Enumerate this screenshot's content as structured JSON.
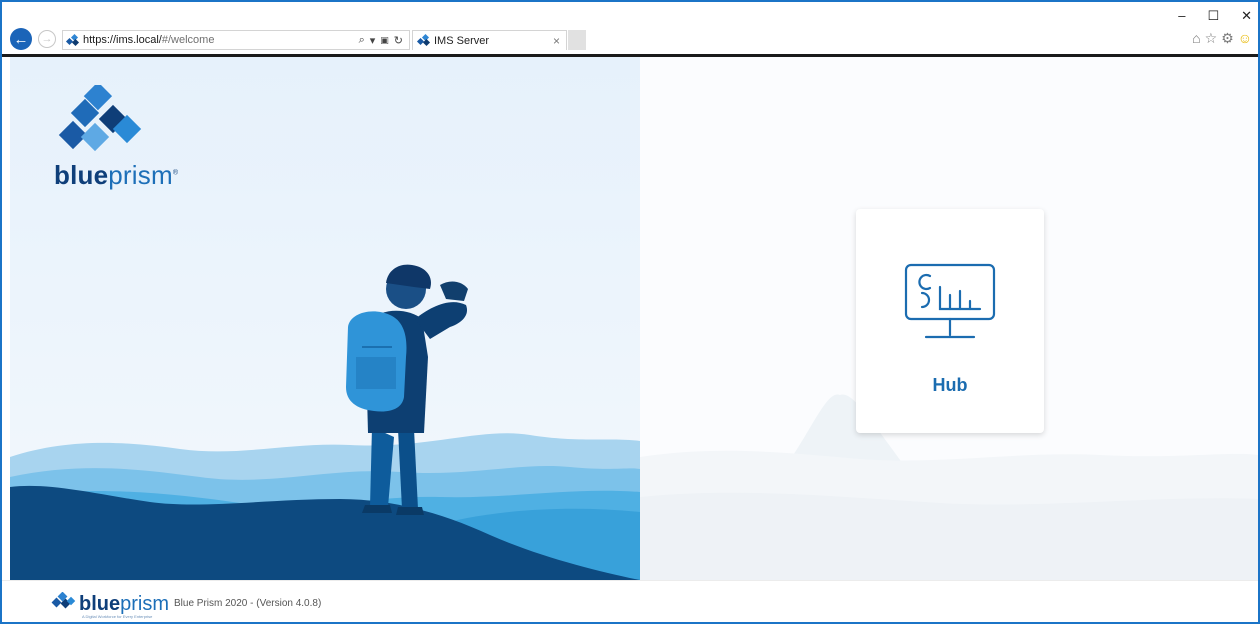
{
  "browser": {
    "address_url_host": "https://ims.local/",
    "address_url_path": "#/welcome",
    "tab_title": "IMS Server",
    "tab_close": "×",
    "search_glyph": "⌕",
    "dropdown_glyph": "▾",
    "lock_glyph": "🔒",
    "refresh_glyph": "↻",
    "window_controls": {
      "minimize": "–",
      "maximize": "☐",
      "close": "✕"
    },
    "toolbar": {
      "home": "⌂",
      "favorites": "☆",
      "settings": "⚙",
      "feedback": "☺"
    },
    "back_glyph": "←",
    "forward_glyph": "→"
  },
  "brand": {
    "bold": "blue",
    "light": "prism",
    "registered": "®"
  },
  "hub": {
    "label": "Hub"
  },
  "footer": {
    "brand_bold": "blue",
    "brand_light": "prism",
    "tagline": "A Digital Workforce for Every Enterprise",
    "version": "Blue Prism 2020 - (Version 4.0.8)"
  },
  "colors": {
    "accent": "#1b6cb0",
    "brand_navy": "#0f3f7a",
    "frame_border": "#1b74c7"
  }
}
